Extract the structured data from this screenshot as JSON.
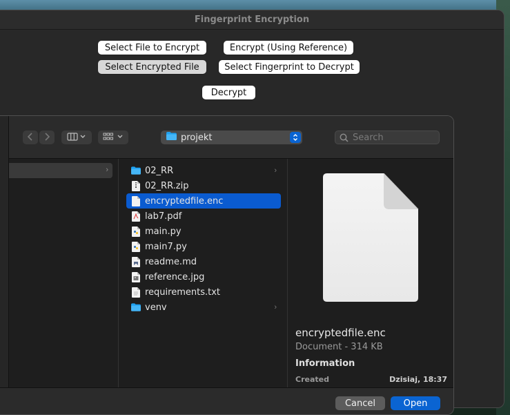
{
  "app": {
    "title": "Fingerprint Encryption",
    "buttons": {
      "select_file_encrypt": "Select File to Encrypt",
      "encrypt_reference": "Encrypt (Using Reference)",
      "select_encrypted": "Select Encrypted File",
      "select_fingerprint": "Select Fingerprint to Decrypt",
      "decrypt": "Decrypt"
    }
  },
  "dialog": {
    "current_folder": "projekt",
    "search_placeholder": "Search",
    "files": [
      {
        "name": "02_RR",
        "icon": "folder-icon",
        "is_folder": true
      },
      {
        "name": "02_RR.zip",
        "icon": "zip-file-icon",
        "is_folder": false
      },
      {
        "name": "encryptedfile.enc",
        "icon": "document-icon",
        "is_folder": false,
        "selected": true
      },
      {
        "name": "lab7.pdf",
        "icon": "pdf-file-icon",
        "is_folder": false
      },
      {
        "name": "main.py",
        "icon": "python-file-icon",
        "is_folder": false
      },
      {
        "name": "main7.py",
        "icon": "python-file-icon",
        "is_folder": false
      },
      {
        "name": "readme.md",
        "icon": "markdown-file-icon",
        "is_folder": false
      },
      {
        "name": "reference.jpg",
        "icon": "image-file-icon",
        "is_folder": false
      },
      {
        "name": "requirements.txt",
        "icon": "text-file-icon",
        "is_folder": false
      },
      {
        "name": "venv",
        "icon": "folder-icon",
        "is_folder": true
      }
    ],
    "preview": {
      "name": "encryptedfile.enc",
      "kind": "Document - 314 KB",
      "information_label": "Information",
      "created_label": "Created",
      "created_value": "Dzisiaj, 18:37"
    },
    "cancel_label": "Cancel",
    "open_label": "Open"
  },
  "colors": {
    "accent": "#0a64d2",
    "selection": "#0a5bd0",
    "folder": "#1ea1f1"
  }
}
